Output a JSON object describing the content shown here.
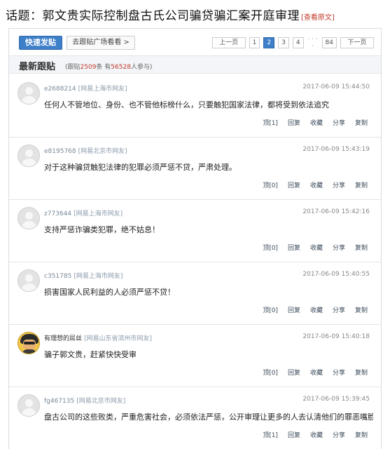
{
  "topic": {
    "title": "话题：郭文贵实际控制盘古氏公司骗贷骗汇案开庭审理",
    "original_link": "[查看原文]"
  },
  "toolbar": {
    "post_button": "快速发贴",
    "square_button": "去跟贴广场看看 >",
    "pager": {
      "prev": "上一页",
      "pages": [
        "1",
        "2",
        "3",
        "4"
      ],
      "active_page": "2",
      "ellipsis": "· · · ·",
      "last": "84",
      "next": "下一页"
    }
  },
  "section": {
    "title": "最新跟贴",
    "stats_prefix": "(跟贴",
    "follow_count": "2509",
    "stats_mid": "条 有",
    "participant_count": "56528",
    "stats_suffix": "人参与)"
  },
  "actions": {
    "top": "顶[{n}]",
    "reply": "回复",
    "favorite": "收藏",
    "share": "分享",
    "copy": "复制"
  },
  "posts": [
    {
      "user": "e2688214",
      "location": "[网易上海市网友]",
      "time": "2017-06-09 15:44:50",
      "content": "任何人不管地位、身份、也不管他标榜什么，只要触犯国家法律，都将受到依法追究",
      "top": "顶[1]"
    },
    {
      "user": "e8195768",
      "location": "[网易北京市网友]",
      "time": "2017-06-09 15:43:19",
      "content": "对于这种骗贷触犯法律的犯罪必须严惩不贷，严肃处理。",
      "top": "顶[0]"
    },
    {
      "user": "z773644",
      "location": "[网易上海市网友]",
      "time": "2017-06-09 15:42:16",
      "content": "支持严惩诈骗类犯罪，绝不姑息！",
      "top": "顶[0]"
    },
    {
      "user": "c351785",
      "location": "[网易上海市网友]",
      "time": "2017-06-09 15:40:55",
      "content": "损害国家人民利益的人必须严惩不贷！",
      "top": "顶[0]"
    },
    {
      "user": "有理想的屌丝",
      "location": "[网易山东省滨州市网友]",
      "time": "2017-06-09 15:40:18",
      "content": "骗子郭文贵，赶紧快快受审",
      "top": "顶[0]"
    },
    {
      "user": "fg467135",
      "location": "[网易北京市网友]",
      "time": "2017-06-09 15:39:45",
      "content": "盘古公司的这些败类，严重危害社会，必须依法严惩，公开审理让更多的人去认清他们的罪恶嘴脸",
      "top": "顶[1]"
    }
  ]
}
